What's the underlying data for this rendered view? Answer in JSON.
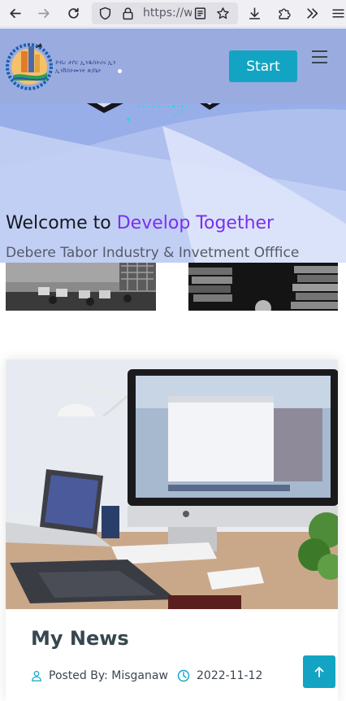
{
  "browser": {
    "url_text": "https://w"
  },
  "header": {
    "logo_line1": "ደብረ ታቦር ኢንዱስትሪና ኢን",
    "logo_line2": "ኢንቨስትመንት ጽ/ቤት",
    "start_label": "Start"
  },
  "hero": {
    "welcome_prefix": "Welcome to ",
    "welcome_highlight": "Develop Together",
    "subtitle": "Debere Tabor Industry & Invetment Offfice"
  },
  "news": {
    "title": "My News",
    "posted_by": "Posted By: Misganaw",
    "date": "2022-11-12"
  },
  "colors": {
    "header_bg": "#9aacdf",
    "accent_teal": "#12a4c2",
    "welcome_highlight": "#7b2ff0",
    "news_title": "#37474f"
  },
  "icons": {
    "back": "arrow-left-icon",
    "forward": "arrow-right-icon",
    "reload": "reload-icon",
    "shield": "shield-icon",
    "lock": "lock-icon",
    "reader": "reader-view-icon",
    "bookmark": "star-icon",
    "download": "download-icon",
    "extensions": "puzzle-icon",
    "overflow": "double-chevron-icon",
    "menu": "hamburger-icon",
    "user": "user-icon",
    "clock": "clock-icon",
    "to_top": "arrow-up-icon"
  }
}
